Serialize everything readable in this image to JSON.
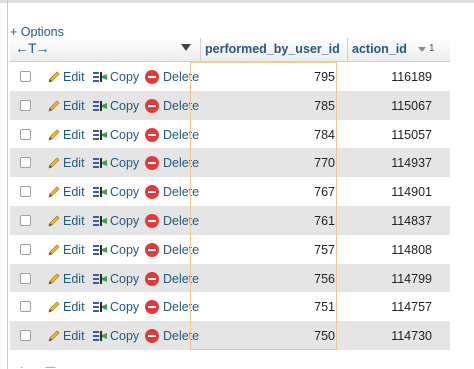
{
  "toolbar": {
    "options_label": "+ Options"
  },
  "header": {
    "arrows": "←T→",
    "col_user": "performed_by_user_id",
    "col_action": "action_id",
    "sort_order": "1"
  },
  "actions": {
    "edit": "Edit",
    "copy": "Copy",
    "delete": "Delete"
  },
  "rows": [
    {
      "performed_by_user_id": "795",
      "action_id": "116189"
    },
    {
      "performed_by_user_id": "785",
      "action_id": "115067"
    },
    {
      "performed_by_user_id": "784",
      "action_id": "115057"
    },
    {
      "performed_by_user_id": "770",
      "action_id": "114937"
    },
    {
      "performed_by_user_id": "767",
      "action_id": "114901"
    },
    {
      "performed_by_user_id": "761",
      "action_id": "114837"
    },
    {
      "performed_by_user_id": "757",
      "action_id": "114808"
    },
    {
      "performed_by_user_id": "756",
      "action_id": "114799"
    },
    {
      "performed_by_user_id": "751",
      "action_id": "114757"
    },
    {
      "performed_by_user_id": "750",
      "action_id": "114730"
    }
  ],
  "colors": {
    "link": "#235a81",
    "row_alt": "#e5e5e5",
    "delete": "#e03a3a",
    "highlight_border": "#f0c890"
  },
  "icons": {
    "edit": "pencil-icon",
    "copy": "copy-icon",
    "delete": "delete-icon",
    "sort": "sort-desc-icon"
  }
}
